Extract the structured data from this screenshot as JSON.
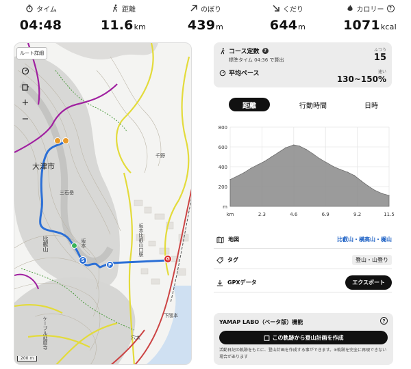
{
  "stats": [
    {
      "label": "タイム",
      "value": "04:48",
      "unit": "",
      "icon": "stopwatch-icon"
    },
    {
      "label": "距離",
      "value": "11.6",
      "unit": "km",
      "icon": "walker-icon"
    },
    {
      "label": "のぼり",
      "value": "439",
      "unit": "m",
      "icon": "arrow-up-right-icon"
    },
    {
      "label": "くだり",
      "value": "644",
      "unit": "m",
      "icon": "arrow-down-right-icon"
    },
    {
      "label": "カロリー",
      "value": "1071",
      "unit": "kcal",
      "icon": "flame-icon"
    }
  ],
  "map": {
    "route_detail_label": "ルート詳細",
    "zoom_in": "+",
    "zoom_out": "−",
    "scale_label": "200 m",
    "labels": {
      "otsu": "大津市",
      "sannomine": "三石岳",
      "hiei": "比叡山",
      "station": "坂本比叡山口駅",
      "chiya": "千野",
      "shimosakamoto": "下阪本",
      "kawaguchi": "穴太",
      "small1": "坂本",
      "road1": "ケーブル延暦寺"
    },
    "markers": {
      "start": "S",
      "goal": "G",
      "parking": "P"
    },
    "colors": {
      "route": "#2b6fd6",
      "boundary": "#a020a0",
      "road": "#e8e04a",
      "rail": "#c44"
    }
  },
  "course": {
    "title": "コース定数",
    "standard_time": "標準タイム 04:36 で算出",
    "difficulty_label": "ふつう",
    "value": "15"
  },
  "pace": {
    "title": "平均ペース",
    "speed_label": "速い",
    "value": "130~150%"
  },
  "tabs": [
    "距離",
    "行動時間",
    "日時"
  ],
  "chart_data": {
    "type": "area",
    "xlabel": "km",
    "x_ticks": [
      "2.3",
      "4.6",
      "6.9",
      "9.2",
      "11.5"
    ],
    "y_ticks": [
      "m",
      "200",
      "400",
      "600",
      "800"
    ],
    "ylim": [
      0,
      800
    ],
    "xlim": [
      0,
      11.5
    ],
    "x": [
      0,
      0.5,
      1.0,
      1.5,
      2.0,
      2.5,
      3.0,
      3.5,
      4.0,
      4.6,
      5.0,
      5.5,
      6.0,
      6.5,
      7.0,
      7.5,
      8.0,
      8.5,
      9.0,
      9.5,
      10.0,
      10.5,
      11.0,
      11.5
    ],
    "values": [
      270,
      305,
      340,
      385,
      420,
      455,
      500,
      545,
      590,
      620,
      610,
      575,
      530,
      480,
      440,
      400,
      370,
      345,
      310,
      255,
      205,
      160,
      130,
      110
    ],
    "grid": true,
    "color": "#8a8a8a"
  },
  "info": {
    "map_label": "地図",
    "map_value": "比叡山・横高山・梶山",
    "tag_label": "タグ",
    "tag_value": "登山・山登り",
    "gpx_label": "GPXデータ",
    "export_label": "エクスポート"
  },
  "labo": {
    "title": "YAMAP LABO（ベータ版）機能",
    "button": "この軌跡から登山計画を作成",
    "note": "活動日記の軌跡をもとに、登山計画を作成する事ができます。※軌跡を完全に再現できない場合があります"
  }
}
